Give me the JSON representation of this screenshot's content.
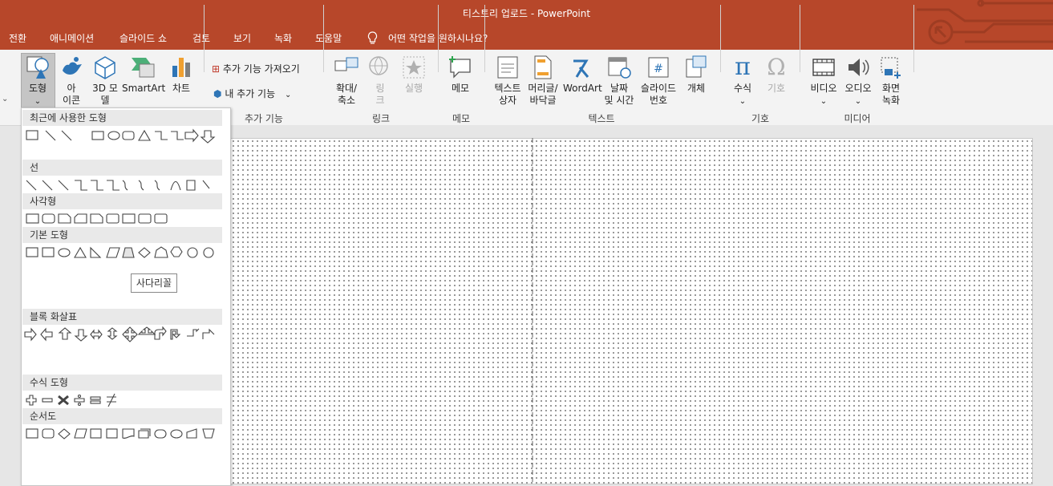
{
  "window": {
    "title": "티스토리 업로드 - PowerPoint"
  },
  "menu": {
    "tabs": [
      "전환",
      "애니메이션",
      "슬라이드 쇼",
      "검토",
      "보기",
      "녹화",
      "도움말"
    ],
    "tell_me": "어떤 작업을 원하시나요?"
  },
  "ribbon": {
    "buttons": {
      "shapes": "도형",
      "icons": "아\n이콘",
      "model3d": "3D 모\n델",
      "smartart": "SmartArt",
      "chart": "차트",
      "get_addins": "추가 기능 가져오기",
      "my_addins": "내 추가 기능",
      "zoom": "확대/\n축소",
      "link": "링\n크",
      "action": "실행",
      "comment": "메모",
      "textbox": "텍스트\n상자",
      "header_footer": "머리글/\n바닥글",
      "wordart": "WordArt",
      "datetime": "날짜\n및 시간",
      "slide_number": "슬라이드\n번호",
      "object": "개체",
      "equation": "수식",
      "symbol": "기호",
      "video": "비디오",
      "audio": "오디오",
      "screen_recording": "화면\n녹화"
    },
    "groups": {
      "addins": "추가 기능",
      "links": "링크",
      "comments": "메모",
      "text": "텍스트",
      "symbols": "기호",
      "media": "미디어"
    }
  },
  "shapes_panel": {
    "categories": [
      "최근에 사용한 도형",
      "선",
      "사각형",
      "기본 도형",
      "블록 화살표",
      "수식 도형",
      "순서도"
    ],
    "tooltip": "사다리꼴"
  },
  "colors": {
    "accent": "#b7472a",
    "icon_blue": "#2e75b6"
  }
}
